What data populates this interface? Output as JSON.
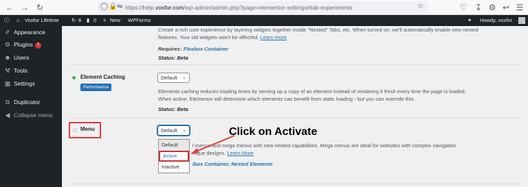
{
  "browser": {
    "url_prefix": "https://help.",
    "url_domain": "voxfor.com",
    "url_rest": "/wp-admin/admin.php?page=elementor-settings#tab-experiments"
  },
  "adminbar": {
    "site_name": "Voxfor Lifetime",
    "updates_count": "8",
    "comments_count": "0",
    "new_label": "New",
    "wpforms_label": "WPForms",
    "greeting": "Howdy, voxfor"
  },
  "sidebar": {
    "items": [
      {
        "label": "Appearance",
        "icon": "paintbrush-icon"
      },
      {
        "label": "Plugins",
        "badge": "7",
        "icon": "plug-icon"
      },
      {
        "label": "Users",
        "icon": "users-icon"
      },
      {
        "label": "Tools",
        "icon": "wrench-icon"
      },
      {
        "label": "Settings",
        "icon": "settings-icon"
      },
      {
        "label": "Duplicator",
        "icon": "duplicator-icon"
      },
      {
        "label": "Collapse menu",
        "icon": "collapse-icon"
      }
    ]
  },
  "nested_tabs": {
    "desc_line1": "Create a rich user experience by layering widgets together inside \"Nested\" Tabs, etc. When turned on, we'll automatically enable new nested",
    "desc_line2": "features. Your old widgets won't be affected.",
    "learn_more": "Learn more",
    "requires_label": "Requires:",
    "requires_value": "Flexbox Container",
    "status": "Status: Beta"
  },
  "element_caching": {
    "label": "Element Caching",
    "tag": "Performance",
    "select_value": "Default",
    "desc_line1": "Elements caching reduces loading times by serving up a copy of an element instead of rendering it fresh every time the page is loaded.",
    "desc_line2": "When active, Elementor will determine which elements can benefit from static loading - but you can override this.",
    "status": "Status: Beta"
  },
  "menu": {
    "label": "Menu",
    "select_value": "Default",
    "options": [
      "Default",
      "Active",
      "Inactive"
    ],
    "desc_line1": "l menus and mega menus with new nested capabilities. Mega menus are ideal for websites with complex navigation",
    "desc_line2": "nique designs.",
    "learn_more": "Learn More",
    "requires_value": "lbox Container, Nested Elements"
  },
  "annotation": {
    "text": "Click on Activate",
    "color": "#e53935"
  }
}
